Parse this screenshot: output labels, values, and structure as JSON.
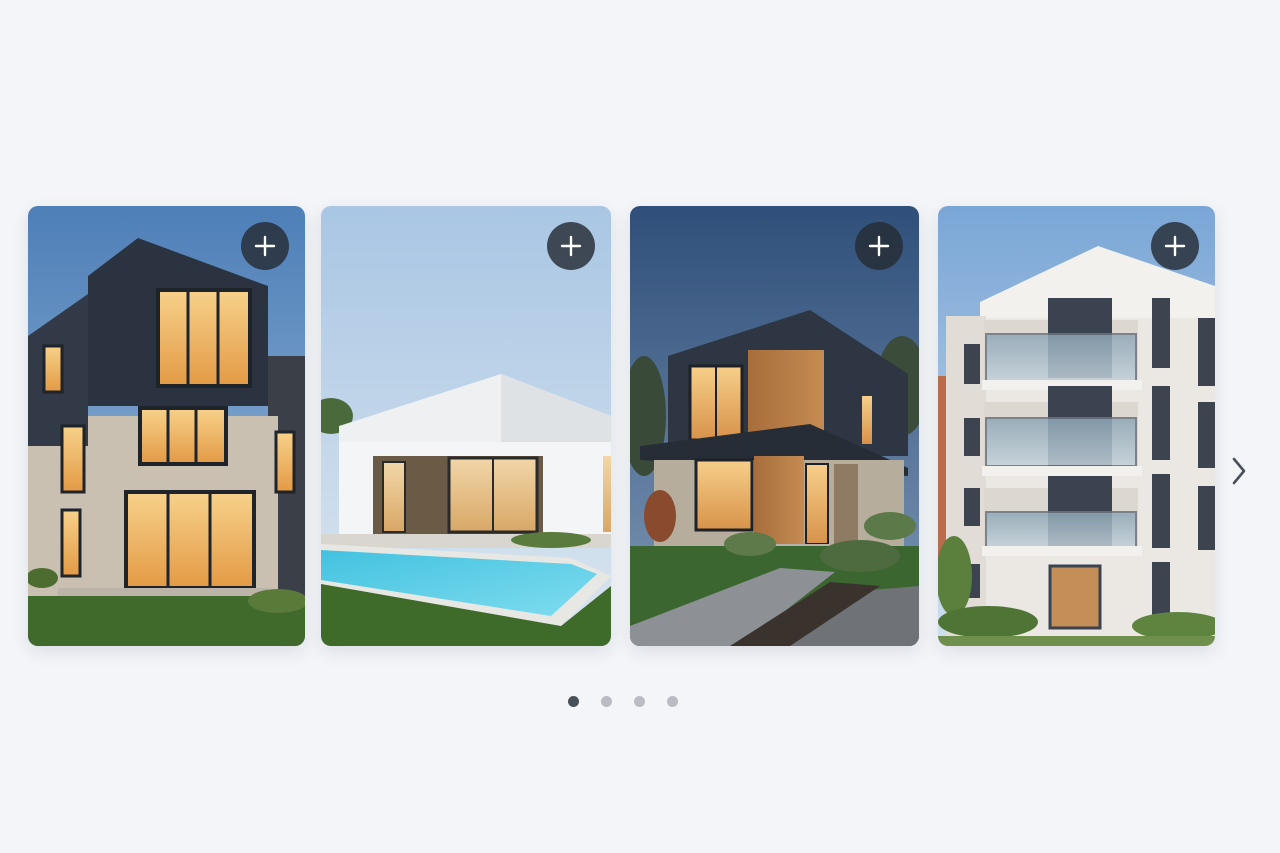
{
  "carousel": {
    "cards": [
      {
        "scene": "modern-dark-house-dusk",
        "action_icon": "plus-icon"
      },
      {
        "scene": "white-house-with-pool",
        "action_icon": "plus-icon"
      },
      {
        "scene": "wood-and-slate-house-dusk",
        "action_icon": "plus-icon"
      },
      {
        "scene": "white-apartment-building",
        "action_icon": "plus-icon"
      }
    ],
    "next_icon": "chevron-right-icon",
    "pagination": {
      "total": 4,
      "active_index": 0
    }
  },
  "colors": {
    "background": "#f3f5f9",
    "add_button_bg": "#262c34",
    "dot_active": "#4a5059",
    "dot_inactive": "#b9bdc3"
  }
}
